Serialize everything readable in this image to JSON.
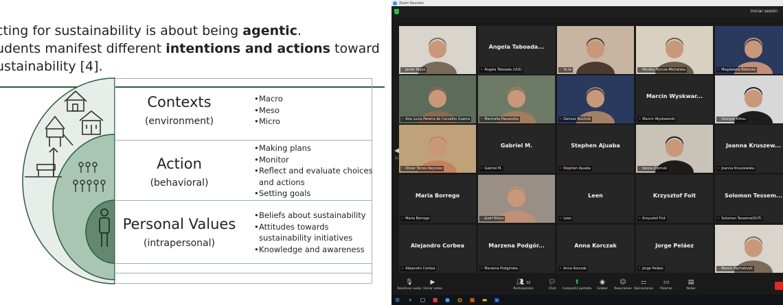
{
  "slide": {
    "intro_lines": [
      {
        "before": "cting for sustainability is about being ",
        "bold": "agentic",
        "after": "."
      },
      {
        "before": "udents manifest different ",
        "bold": "intentions and actions",
        "after": " toward"
      },
      {
        "before": "ustainability [4].",
        "bold": "",
        "after": ""
      }
    ],
    "layers": [
      {
        "title": "Contexts",
        "subtitle": "(environment)",
        "bullets": [
          "Macro",
          "Meso",
          "Micro"
        ]
      },
      {
        "title": "Action",
        "subtitle": "(behavioral)",
        "bullets": [
          "Making plans",
          "Monitor",
          "Reflect and evaluate choices",
          "and actions",
          "Setting goals"
        ]
      },
      {
        "title": "Personal Values",
        "subtitle": "(intrapersonal)",
        "bullets": [
          "Beliefs about sustainability",
          "Attitudes towards",
          "sustainability initiatives",
          "Knowledge and awareness"
        ]
      }
    ],
    "colors": {
      "outer": "#e7ede9",
      "middle": "#a9c5b3",
      "inner": "#64886f",
      "line": "#2e5a3d"
    }
  },
  "zoom": {
    "window_title": "Zoom Reunión",
    "exit_fullscreen": "Iniciar sesión",
    "page_indicator": "1/2",
    "tiles": [
      {
        "label": "Javier Rojas",
        "big": "",
        "photo": true
      },
      {
        "label": "Angela Taboada (ULE)",
        "big": "Angela Taboada...",
        "photo": false
      },
      {
        "label": "Ya te",
        "big": "",
        "photo": true
      },
      {
        "label": "Monika Hyrcza-Michalska",
        "big": "",
        "photo": true
      },
      {
        "label": "Magdalena Bielecka",
        "big": "",
        "photo": true
      },
      {
        "label": "Ana Lucia Pereira de Carvalho Guerra",
        "big": "",
        "photo": true,
        "active": true
      },
      {
        "label": "Marinella Passarella",
        "big": "",
        "photo": true
      },
      {
        "label": "Dariusz Buchcik",
        "big": "",
        "photo": true
      },
      {
        "label": "Marcin Wyskwarski",
        "big": "Marcin Wyskwar...",
        "photo": false
      },
      {
        "label": "Georgia Kittou",
        "big": "",
        "photo": true
      },
      {
        "label": "Oliver Torres Reynoso",
        "big": "",
        "photo": true
      },
      {
        "label": "Gabriel M.",
        "big": "Gabriel M.",
        "photo": false
      },
      {
        "label": "Stephen Ajuaba",
        "big": "Stephen Ajuaba",
        "photo": false
      },
      {
        "label": "Iwona Zdoński",
        "big": "",
        "photo": true
      },
      {
        "label": "Joanna Kruszewska",
        "big": "Joanna Kruszew...",
        "photo": false
      },
      {
        "label": "Maria Borrego",
        "big": "Maria Borrego",
        "photo": false
      },
      {
        "label": "Józef Wiora",
        "big": "",
        "photo": true
      },
      {
        "label": "Leen",
        "big": "Leen",
        "photo": false
      },
      {
        "label": "Krzysztof Foit",
        "big": "Krzysztof Foit",
        "photo": false
      },
      {
        "label": "Solomon Tessema(SUT)",
        "big": "Solomon Tessem...",
        "photo": false
      },
      {
        "label": "Alejandro Corbea",
        "big": "Alejandro Corbea",
        "photo": false
      },
      {
        "label": "Marzena Podgórska",
        "big": "Marzena Podgór...",
        "photo": false
      },
      {
        "label": "Anna Korczak",
        "big": "Anna Korczak",
        "photo": false
      },
      {
        "label": "Jorge Peláez",
        "big": "Jorge Peláez",
        "photo": false
      },
      {
        "label": "Marcin Pachołczyk",
        "big": "",
        "photo": true
      }
    ],
    "toolbar": [
      {
        "icon": "mic-icon",
        "label": "Reactivar audio"
      },
      {
        "icon": "video-icon",
        "label": "Iniciar video"
      },
      {
        "icon": "participants-icon",
        "label": "Participantes",
        "count": "32"
      },
      {
        "icon": "chat-icon",
        "label": "Chat"
      },
      {
        "icon": "share-screen-icon",
        "label": "Compartir pantalla"
      },
      {
        "icon": "record-icon",
        "label": "Grabar"
      },
      {
        "icon": "reactions-icon",
        "label": "Reacciones"
      },
      {
        "icon": "apps-icon",
        "label": "Aplicaciones"
      },
      {
        "icon": "whiteboard-icon",
        "label": "Pizarras"
      },
      {
        "icon": "notes-icon",
        "label": "Notas"
      }
    ],
    "accent_active": "#e6d53c",
    "accent_green": "#23c552"
  }
}
